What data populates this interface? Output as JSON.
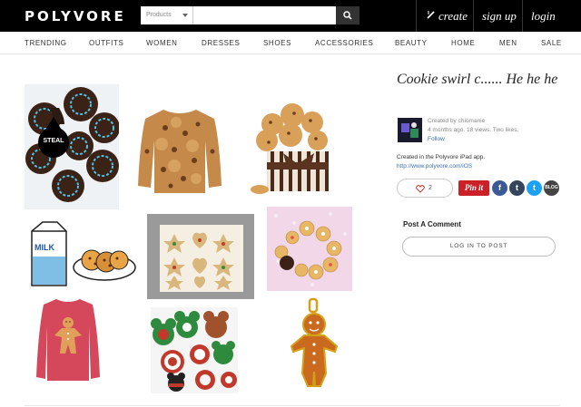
{
  "header": {
    "logo": "POLYVORE",
    "search": {
      "category": "Products",
      "value": ""
    },
    "links": {
      "create": "create",
      "signup": "sign up",
      "login": "login"
    }
  },
  "nav": [
    "TRENDING",
    "OUTFITS",
    "WOMEN",
    "DRESSES",
    "SHOES",
    "ACCESSORIES",
    "BEAUTY",
    "HOME",
    "MEN",
    "SALE"
  ],
  "collage": {
    "steal_badge": "STEAL"
  },
  "set": {
    "title": "Cookie swirl c...... He he he",
    "created_by_prefix": "Created by",
    "author": "chlomanie",
    "stats": "4 months ago. 18 views. Two likes.",
    "follow": "Follow",
    "app_note": "Created in the Polyvore iPad app.",
    "app_link": "http://www.polyvore.com/iOS",
    "like_count": "2",
    "pin_label": "Pin it",
    "share": {
      "facebook": "f",
      "tumblr": "t",
      "twitter": "t",
      "blog": "BLOG"
    }
  },
  "comments": {
    "heading": "Post A Comment",
    "login_button": "LOG IN TO POST"
  },
  "colors": {
    "header_bg": "#000000",
    "pinterest": "#cb2027",
    "facebook": "#3b5998",
    "tumblr": "#35465c",
    "twitter": "#1da1f2",
    "blog": "#444444",
    "link": "#3b6fb6"
  }
}
